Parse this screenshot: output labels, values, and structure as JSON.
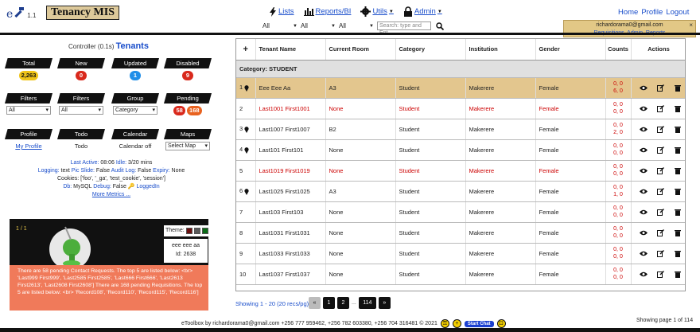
{
  "header": {
    "logo_letter": "e",
    "logo_version": "1.1",
    "brand": "Tenancy MIS",
    "nav": [
      {
        "label": "Lists",
        "icon": "bolt-icon"
      },
      {
        "label": "Reports/BI",
        "icon": "bar-chart-icon"
      },
      {
        "label": "Utils",
        "icon": "gear-icon"
      },
      {
        "label": "Admin",
        "icon": "lock-icon"
      }
    ],
    "filters": [
      "All",
      "All",
      "All"
    ],
    "search_placeholder": "Search: type and Ent",
    "right_links": [
      "Home",
      "Profile",
      "Logout"
    ],
    "user_popup": {
      "email": "richardorama0@gmail.com",
      "links": "Requisitions, Admin, Reports",
      "close": "×"
    }
  },
  "controller": {
    "prefix": "Controller (0.1s)",
    "name": "Tenants"
  },
  "stats": [
    {
      "label": "Total",
      "value": "2,263",
      "color": "#f0c419",
      "text": "#111"
    },
    {
      "label": "New",
      "value": "0",
      "color": "#d9291c",
      "text": "#fff"
    },
    {
      "label": "Updated",
      "value": "1",
      "color": "#1f8ee8",
      "text": "#fff"
    },
    {
      "label": "Disabled",
      "value": "9",
      "color": "#d9291c",
      "text": "#fff"
    }
  ],
  "row2": {
    "filters1": {
      "label": "Filters",
      "value": "All"
    },
    "filters2": {
      "label": "Filters",
      "value": "All"
    },
    "group": {
      "label": "Group",
      "value": "Category"
    },
    "pending": {
      "label": "Pending",
      "a": "58",
      "b": "168"
    }
  },
  "row3": {
    "profile": {
      "label": "Profile",
      "link": "My Profile"
    },
    "todo": {
      "label": "Todo",
      "text": "Todo"
    },
    "calendar": {
      "label": "Calendar",
      "text": "Calendar off"
    },
    "maps": {
      "label": "Maps",
      "value": "Select Map"
    }
  },
  "info": {
    "last_active_label": "Last Active:",
    "last_active": "08:06",
    "idle_label": "Idle:",
    "idle": "3/20 mins",
    "logging_label": "Logging:",
    "logging": "text",
    "pic_slide_label": "Pic Slide:",
    "pic_slide": "False",
    "audit_label": "Audit Log:",
    "audit": "False",
    "expiry_label": "Expiry:",
    "expiry": "None",
    "cookies": "Cookies: ['foo', '_ga', 'test_cookie', 'session']",
    "db_label": "Db:",
    "db": "MySQL",
    "debug_label": "Debug:",
    "debug": "False",
    "logged_in": "LoggedIn",
    "more": "More Metrics ..."
  },
  "feature": {
    "count": "1 / 1",
    "theme_label": "Theme:",
    "theme_colors": [
      "#6b0f0f",
      "#5a5a5a",
      "#0a6b16"
    ],
    "card_name": "eee eee aa",
    "card_id": "Id: 2638",
    "message": "There are 58 pending Contact Requests. The top 5 are listed below: <br> 'Last999 First999', 'Last2585 First2585', 'Last666 First666', 'Last2613 First2613', 'Last2608 First2608'] There are 168 pending Requisitions. The top 5 are listed below: <br> 'Record108', 'Record110', 'Record115', 'Record116']"
  },
  "table": {
    "add_symbol": "+",
    "columns": [
      "Tenant Name",
      "Current Room",
      "Category",
      "Institution",
      "Gender",
      "Counts",
      "Actions"
    ],
    "category_label": "Category: STUDENT",
    "rows": [
      {
        "num": "1",
        "pin": true,
        "name": "Eee Eee Aa",
        "room": "A3",
        "cat": "Student",
        "inst": "Makerere",
        "gender": "Female",
        "c1": "0, 0",
        "c2": "6, 0",
        "state": "selected"
      },
      {
        "num": "2",
        "pin": false,
        "name": "Last1001 First1001",
        "room": "None",
        "cat": "Student",
        "inst": "Makerere",
        "gender": "Female",
        "c1": "0, 0",
        "c2": "0, 0",
        "state": "warn"
      },
      {
        "num": "3",
        "pin": true,
        "name": "Last1007 First1007",
        "room": "B2",
        "cat": "Student",
        "inst": "Makerere",
        "gender": "Female",
        "c1": "0, 0",
        "c2": "2, 0",
        "state": ""
      },
      {
        "num": "4",
        "pin": true,
        "name": "Last101 First101",
        "room": "None",
        "cat": "Student",
        "inst": "Makerere",
        "gender": "Female",
        "c1": "0, 0",
        "c2": "0, 0",
        "state": ""
      },
      {
        "num": "5",
        "pin": false,
        "name": "Last1019 First1019",
        "room": "None",
        "cat": "Student",
        "inst": "Makerere",
        "gender": "Female",
        "c1": "0, 0",
        "c2": "0, 0",
        "state": "warn"
      },
      {
        "num": "6",
        "pin": true,
        "name": "Last1025 First1025",
        "room": "A3",
        "cat": "Student",
        "inst": "Makerere",
        "gender": "Female",
        "c1": "0, 0",
        "c2": "1, 0",
        "state": ""
      },
      {
        "num": "7",
        "pin": false,
        "name": "Last103 First103",
        "room": "None",
        "cat": "Student",
        "inst": "Makerere",
        "gender": "Female",
        "c1": "0, 0",
        "c2": "0, 0",
        "state": ""
      },
      {
        "num": "8",
        "pin": false,
        "name": "Last1031 First1031",
        "room": "None",
        "cat": "Student",
        "inst": "Makerere",
        "gender": "Female",
        "c1": "0, 0",
        "c2": "0, 0",
        "state": ""
      },
      {
        "num": "9",
        "pin": false,
        "name": "Last1033 First1033",
        "room": "None",
        "cat": "Student",
        "inst": "Makerere",
        "gender": "Female",
        "c1": "0, 0",
        "c2": "0, 0",
        "state": ""
      },
      {
        "num": "10",
        "pin": false,
        "name": "Last1037 First1037",
        "room": "None",
        "cat": "Student",
        "inst": "Makerere",
        "gender": "Female",
        "c1": "0, 0",
        "c2": "0, 0",
        "state": ""
      }
    ]
  },
  "pager": {
    "showing": "Showing 1 - 20 (20 recs/pg)",
    "prev": "«",
    "pages": [
      "1",
      "2"
    ],
    "dots": "...",
    "last": "114",
    "next": "»",
    "page_of": "Showing page 1 of 114"
  },
  "footer": {
    "text": "eToolbox by richardorama0@gmail.com +256 777 959462, +256 782 603380, +256 704 316481 © 2021",
    "chat": "Start Chat"
  }
}
